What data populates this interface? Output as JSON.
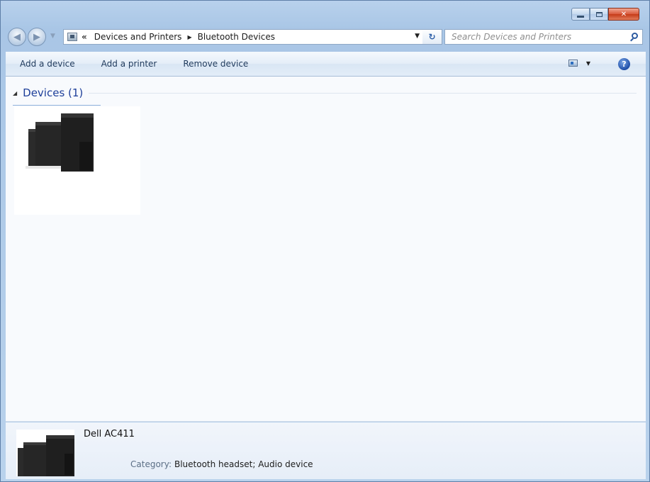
{
  "window": {
    "caption": {
      "minimize_icon": "minimize-icon",
      "maximize_icon": "maximize-icon",
      "close_icon": "close-icon",
      "close_glyph": "✕"
    }
  },
  "nav": {
    "back_glyph": "◀",
    "forward_glyph": "▶",
    "breadcrumb_overflow": "«",
    "breadcrumbs": [
      "Devices and Printers",
      "Bluetooth Devices"
    ],
    "refresh_glyph": "↻",
    "search_placeholder": "Search Devices and Printers"
  },
  "toolbar": {
    "add_device": "Add a device",
    "add_printer": "Add a printer",
    "remove_device": "Remove device",
    "help_glyph": "?"
  },
  "content": {
    "group_title": "Devices (1)",
    "devices": [
      {
        "name": "Dell AC411",
        "icon": "speaker-icon"
      }
    ]
  },
  "details": {
    "name": "Dell AC411",
    "category_label": "Category:",
    "category_value": "Bluetooth headset; Audio device"
  },
  "colors": {
    "accent": "#1e3f9a",
    "close_red": "#c53a17",
    "frame": "#b8d1ec"
  }
}
